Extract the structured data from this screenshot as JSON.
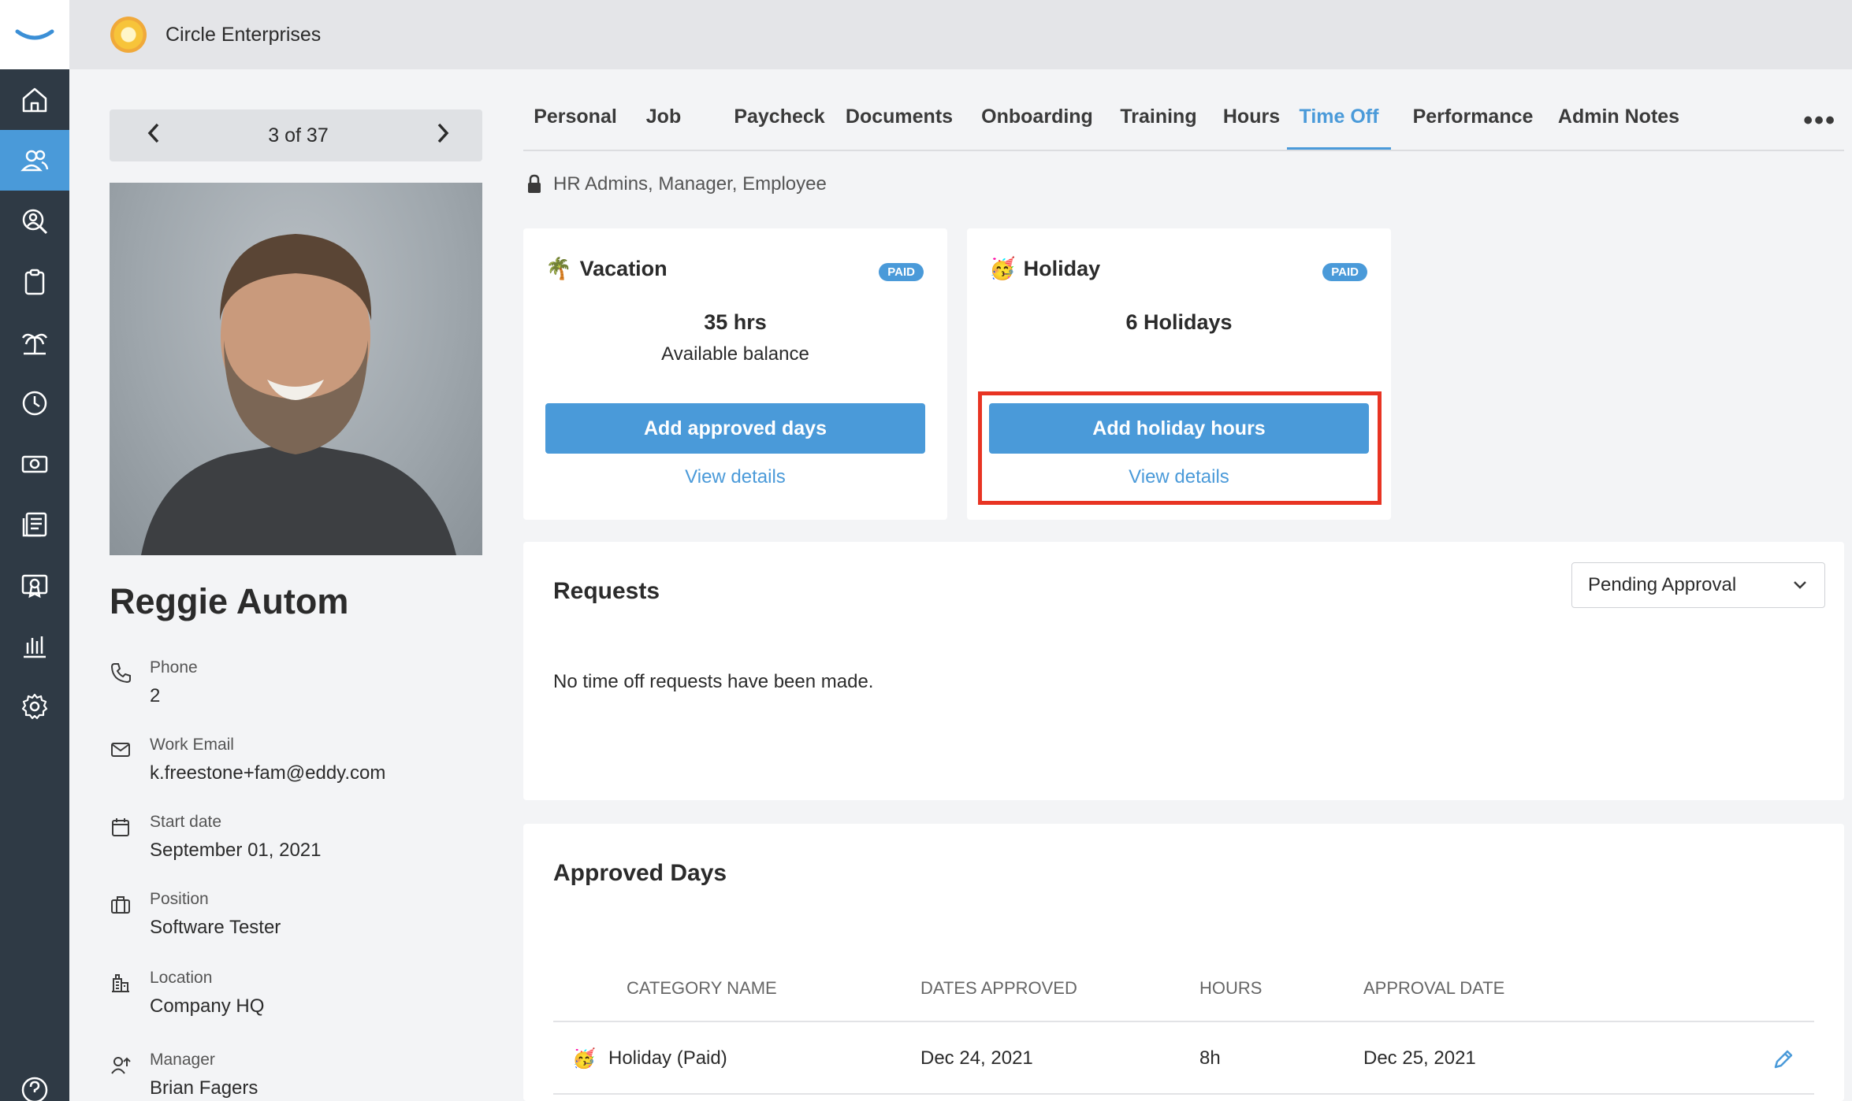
{
  "company": {
    "name": "Circle Enterprises"
  },
  "pager": {
    "count": "3 of 37",
    "prev": "‹",
    "next": "›"
  },
  "profile": {
    "name": "Reggie Autom",
    "fields": [
      {
        "label": "Phone",
        "value": "2"
      },
      {
        "label": "Work Email",
        "value": "k.freestone+fam@eddy.com"
      },
      {
        "label": "Start date",
        "value": "September 01, 2021"
      },
      {
        "label": "Position",
        "value": "Software Tester"
      },
      {
        "label": "Location",
        "value": "Company HQ"
      },
      {
        "label": "Manager",
        "value": "Brian Fagers"
      }
    ]
  },
  "tabs": [
    "Personal",
    "Job",
    "Paycheck",
    "Documents",
    "Onboarding",
    "Training",
    "Hours",
    "Time Off",
    "Performance",
    "Admin Notes"
  ],
  "active_tab": "Time Off",
  "more": "•••",
  "access": "HR Admins, Manager, Employee",
  "vacation": {
    "icon": "🌴",
    "title": "Vacation",
    "badge": "PAID",
    "amount": "35 hrs",
    "sub": "Available balance",
    "button": "Add approved days",
    "link": "View details"
  },
  "holiday": {
    "icon": "🥳",
    "title": "Holiday",
    "badge": "PAID",
    "amount": "6 Holidays",
    "button": "Add holiday hours",
    "link": "View details"
  },
  "requests": {
    "title": "Requests",
    "filter": "Pending Approval",
    "empty": "No time off requests have been made."
  },
  "approved": {
    "title": "Approved Days",
    "columns": [
      "CATEGORY NAME",
      "DATES APPROVED",
      "HOURS",
      "APPROVAL DATE"
    ],
    "rows": [
      {
        "icon": "🥳",
        "category": "Holiday (Paid)",
        "dates": "Dec 24, 2021",
        "hours": "8h",
        "approval_date": "Dec 25, 2021"
      }
    ]
  },
  "colors": {
    "accent": "#4a9ad9",
    "rail": "#2f3a45",
    "highlight": "#e83423"
  }
}
